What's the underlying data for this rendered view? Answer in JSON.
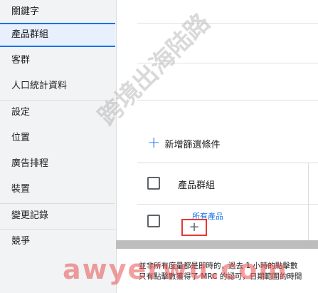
{
  "sidebar": {
    "items": [
      {
        "label": "關鍵字"
      },
      {
        "label": "產品群組"
      },
      {
        "label": "客群"
      },
      {
        "label": "人口統計資料"
      },
      {
        "label": "設定"
      },
      {
        "label": "位置"
      },
      {
        "label": "廣告排程"
      },
      {
        "label": "裝置"
      },
      {
        "label": "變更記錄"
      },
      {
        "label": "競爭"
      }
    ]
  },
  "main": {
    "add_filter_label": "新增篩選條件",
    "table": {
      "column_header": "產品群組",
      "row_link": "所有產品"
    },
    "footnote": {
      "line1": "並非所有度量都是即時的，過去 1 小時的點擊數",
      "line2": "只有點擊數獲得了 MRC 的認可，日期範圍的時間"
    }
  },
  "watermark": {
    "text": "跨境出海陆路",
    "url": "awyerwu.com"
  },
  "colors": {
    "accent": "#1a73e8",
    "highlight_box": "#e53935"
  }
}
